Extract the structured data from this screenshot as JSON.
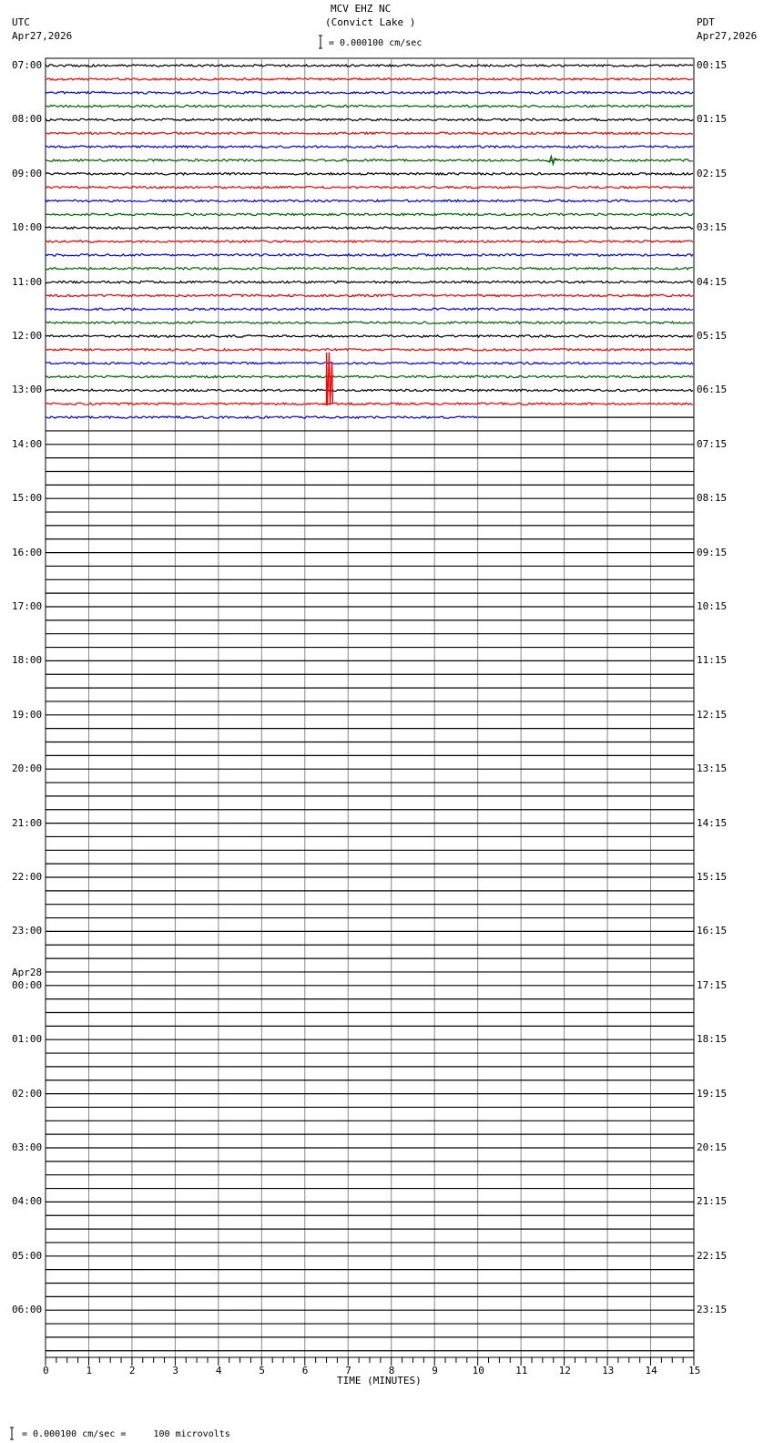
{
  "header": {
    "title": "MCV EHZ NC",
    "subtitle": "(Convict Lake )",
    "scale_text": "= 0.000100 cm/sec",
    "left_tz": "UTC",
    "left_date": "Apr27,2026",
    "right_tz": "PDT",
    "right_date": "Apr27,2026"
  },
  "footer": {
    "scale_text": "= 0.000100 cm/sec =     100 microvolts"
  },
  "chart_data": {
    "type": "line",
    "title": "MCV EHZ NC (Convict Lake )",
    "xlabel": "TIME (MINUTES)",
    "xlim": [
      0,
      15
    ],
    "x_ticks": [
      "0",
      "1",
      "2",
      "3",
      "4",
      "5",
      "6",
      "7",
      "8",
      "9",
      "10",
      "11",
      "12",
      "13",
      "14",
      "15"
    ],
    "rows_per_hour": 4,
    "total_rows": 96,
    "trace_colors": [
      "#000000",
      "#ff0000",
      "#0000ff",
      "#006400"
    ],
    "rows_with_data": 27,
    "last_row_end_minute": 10,
    "left_labels": [
      "07:00",
      "08:00",
      "09:00",
      "10:00",
      "11:00",
      "12:00",
      "13:00",
      "14:00",
      "15:00",
      "16:00",
      "17:00",
      "18:00",
      "19:00",
      "20:00",
      "21:00",
      "22:00",
      "23:00",
      "00:00",
      "01:00",
      "02:00",
      "03:00",
      "04:00",
      "05:00",
      "06:00"
    ],
    "left_date_change": {
      "hour_index": 17,
      "label": "Apr28"
    },
    "right_labels": [
      "00:15",
      "01:15",
      "02:15",
      "03:15",
      "04:15",
      "05:15",
      "06:15",
      "07:15",
      "08:15",
      "09:15",
      "10:15",
      "11:15",
      "12:15",
      "13:15",
      "14:15",
      "15:15",
      "16:15",
      "17:15",
      "18:15",
      "19:15",
      "20:15",
      "21:15",
      "22:15",
      "23:15"
    ],
    "events": [
      {
        "row": 7,
        "minute": 11.7,
        "amplitude_rows": 0.3
      },
      {
        "row": 25,
        "minute": 6.5,
        "amplitude_rows": 3.8
      }
    ]
  }
}
